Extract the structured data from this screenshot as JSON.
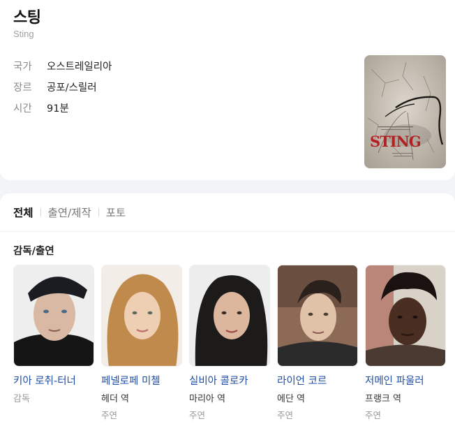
{
  "movie": {
    "title": "스팅",
    "original_title": "Sting",
    "info": [
      {
        "key": "국가",
        "value": "오스트레일리아"
      },
      {
        "key": "장르",
        "value": "공포/스릴러"
      },
      {
        "key": "시간",
        "value": "91분"
      }
    ],
    "poster_text": "STING"
  },
  "tabs": [
    {
      "label": "전체",
      "active": true
    },
    {
      "label": "출연/제작",
      "active": false
    },
    {
      "label": "포토",
      "active": false
    }
  ],
  "section_title": "감독/출연",
  "cast": [
    {
      "name": "키아 로취-터너",
      "role": "감독",
      "type": ""
    },
    {
      "name": "페넬로페 미첼",
      "role": "헤더 역",
      "type": "주연"
    },
    {
      "name": "실비아 콜로카",
      "role": "마리아 역",
      "type": "주연"
    },
    {
      "name": "라이언 코르",
      "role": "에단 역",
      "type": "주연"
    },
    {
      "name": "저메인 파울러",
      "role": "프랭크 역",
      "type": "주연"
    }
  ]
}
